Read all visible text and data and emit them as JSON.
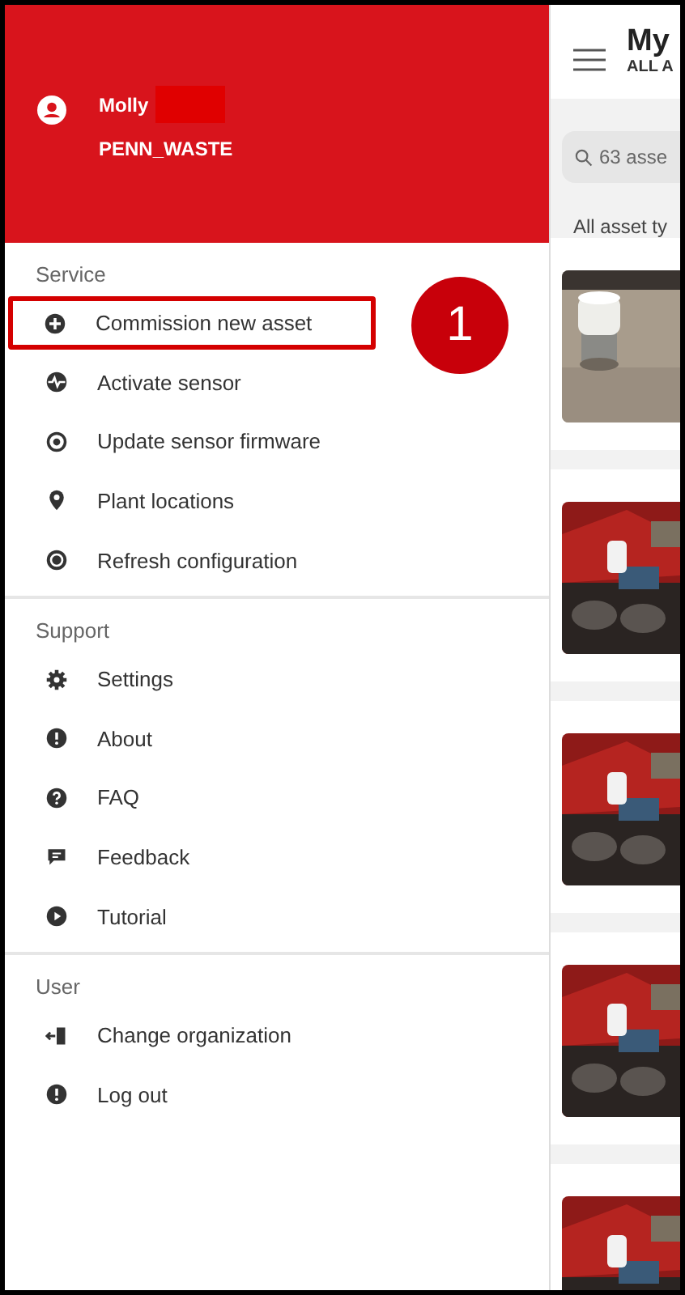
{
  "drawer": {
    "user": {
      "name": "Molly",
      "organization": "PENN_WASTE"
    },
    "sections": [
      {
        "title": "Service",
        "items": [
          {
            "label": "Commission new asset",
            "highlighted": true
          },
          {
            "label": "Activate sensor",
            "highlighted": false
          },
          {
            "label": "Update sensor firmware",
            "highlighted": false
          },
          {
            "label": "Plant locations",
            "highlighted": false
          },
          {
            "label": "Refresh configuration",
            "highlighted": false
          }
        ]
      },
      {
        "title": "Support",
        "items": [
          {
            "label": "Settings",
            "highlighted": false
          },
          {
            "label": "About",
            "highlighted": false
          },
          {
            "label": "FAQ",
            "highlighted": false
          },
          {
            "label": "Feedback",
            "highlighted": false
          },
          {
            "label": "Tutorial",
            "highlighted": false
          }
        ]
      },
      {
        "title": "User",
        "items": [
          {
            "label": "Change organization",
            "highlighted": false
          },
          {
            "label": "Log out",
            "highlighted": false
          }
        ]
      }
    ]
  },
  "callout": {
    "number": "1"
  },
  "background_screen": {
    "title": "My",
    "subtitle": "ALL A",
    "search": {
      "placeholder": "63 asse"
    },
    "filter": "All asset ty"
  }
}
